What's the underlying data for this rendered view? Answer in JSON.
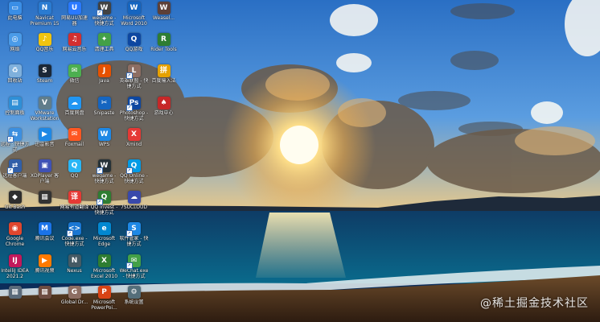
{
  "colors": {
    "sky_top": "#2a6fc4",
    "sun": "#fff2b3",
    "sea": "#0f4c7a",
    "sand": "#4a3420"
  },
  "watermark": "@稀土掘金技术社区",
  "desktop_icons": [
    {
      "label": "此电脑",
      "icon": "computer-icon",
      "color": "#3a8ee6",
      "glyph": "▭",
      "shortcut": false
    },
    {
      "label": "网络",
      "icon": "network-icon",
      "color": "#4a9be8",
      "glyph": "◎",
      "shortcut": false
    },
    {
      "label": "回收站",
      "icon": "recycle-bin-icon",
      "color": "#7fb0dc",
      "glyph": "♻",
      "shortcut": false
    },
    {
      "label": "控制面板",
      "icon": "control-panel-icon",
      "color": "#2f8fd6",
      "glyph": "▤",
      "shortcut": false
    },
    {
      "label": "远程 · 快捷方式",
      "icon": "remote-desktop-icon",
      "color": "#3c8fe0",
      "glyph": "⇆",
      "shortcut": true
    },
    {
      "label": "远程客户端",
      "icon": "remote-client-icon",
      "color": "#315fa8",
      "glyph": "⇄",
      "shortcut": true
    },
    {
      "label": "Git Bash",
      "icon": "git-bash-icon",
      "color": "#2e2e2e",
      "glyph": "◆",
      "shortcut": false
    },
    {
      "label": "Google Chrome",
      "icon": "chrome-icon",
      "color": "#e0462e",
      "glyph": "◉",
      "shortcut": false
    },
    {
      "label": "IntelliJ IDEA 2021.2",
      "icon": "intellij-icon",
      "color": "#c2185b",
      "glyph": "IJ",
      "shortcut": false
    },
    {
      "label": "",
      "icon": "app-icon",
      "color": "#5a6a7a",
      "glyph": "▦",
      "shortcut": false
    },
    {
      "label": "Navicat Premium 15",
      "icon": "navicat-icon",
      "color": "#2a7bd1",
      "glyph": "N",
      "shortcut": false
    },
    {
      "label": "QQ音乐",
      "icon": "qq-music-icon",
      "color": "#f1c40f",
      "glyph": "♪",
      "shortcut": false
    },
    {
      "label": "Steam",
      "icon": "steam-icon",
      "color": "#1b2838",
      "glyph": "S",
      "shortcut": false
    },
    {
      "label": "VMware Workstation",
      "icon": "vmware-icon",
      "color": "#607d8b",
      "glyph": "V",
      "shortcut": false
    },
    {
      "label": "迅雷影音",
      "icon": "video-player-icon",
      "color": "#1e88e5",
      "glyph": "▶",
      "shortcut": false
    },
    {
      "label": "XDPlayer 客户端",
      "icon": "xdplayer-icon",
      "color": "#3f51b5",
      "glyph": "▣",
      "shortcut": false
    },
    {
      "label": "",
      "icon": "app-icon",
      "color": "#333333",
      "glyph": "▦",
      "shortcut": false
    },
    {
      "label": "腾讯会议",
      "icon": "tencent-meeting-icon",
      "color": "#1a73e8",
      "glyph": "M",
      "shortcut": false
    },
    {
      "label": "腾讯视频",
      "icon": "tencent-video-icon",
      "color": "#ff7a00",
      "glyph": "▶",
      "shortcut": false
    },
    {
      "label": "",
      "icon": "app-icon",
      "color": "#6d4c41",
      "glyph": "▦",
      "shortcut": false
    },
    {
      "label": "网易UU加速器",
      "icon": "uu-booster-icon",
      "color": "#2979ff",
      "glyph": "U",
      "shortcut": false
    },
    {
      "label": "网易云音乐",
      "icon": "netease-music-icon",
      "color": "#d32f2f",
      "glyph": "♫",
      "shortcut": false
    },
    {
      "label": "微信",
      "icon": "wechat-icon",
      "color": "#4caf50",
      "glyph": "✉",
      "shortcut": false
    },
    {
      "label": "百度网盘",
      "icon": "baidu-netdisk-icon",
      "color": "#2196f3",
      "glyph": "☁",
      "shortcut": false
    },
    {
      "label": "Foxmail",
      "icon": "foxmail-icon",
      "color": "#ff5722",
      "glyph": "✉",
      "shortcut": false
    },
    {
      "label": "QQ",
      "icon": "qq-icon",
      "color": "#29b6f6",
      "glyph": "Q",
      "shortcut": false
    },
    {
      "label": "网易有道翻译",
      "icon": "youdao-icon",
      "color": "#e53935",
      "glyph": "译",
      "shortcut": false
    },
    {
      "label": "Code.exe - 快捷方式",
      "icon": "vscode-icon",
      "color": "#1976d2",
      "glyph": "<>",
      "shortcut": true
    },
    {
      "label": "Nexus",
      "icon": "nexus-icon",
      "color": "#455a64",
      "glyph": "N",
      "shortcut": false
    },
    {
      "label": "Global Dr...",
      "icon": "global-icon",
      "color": "#8d6e63",
      "glyph": "G",
      "shortcut": false
    },
    {
      "label": "wegame - 快捷方式",
      "icon": "wegame-icon",
      "color": "#424242",
      "glyph": "W",
      "shortcut": true
    },
    {
      "label": "清理工具",
      "icon": "cleaner-icon",
      "color": "#43a047",
      "glyph": "✦",
      "shortcut": false
    },
    {
      "label": "Java",
      "icon": "java-icon",
      "color": "#e65100",
      "glyph": "J",
      "shortcut": false
    },
    {
      "label": "Snipaste",
      "icon": "snipaste-icon",
      "color": "#1565c0",
      "glyph": "✂",
      "shortcut": false
    },
    {
      "label": "WPS",
      "icon": "wps-icon",
      "color": "#1e88e5",
      "glyph": "W",
      "shortcut": false
    },
    {
      "label": "wegame - 快捷方式",
      "icon": "wegame-icon",
      "color": "#263238",
      "glyph": "W",
      "shortcut": true
    },
    {
      "label": "QQ Invest - 快捷方式",
      "icon": "qq-invest-icon",
      "color": "#2e7d32",
      "glyph": "Q",
      "shortcut": true
    },
    {
      "label": "Microsoft Edge",
      "icon": "edge-icon",
      "color": "#0288d1",
      "glyph": "e",
      "shortcut": false
    },
    {
      "label": "Microsoft Excel 2010",
      "icon": "excel-icon",
      "color": "#2e7d32",
      "glyph": "X",
      "shortcut": false
    },
    {
      "label": "Microsoft PowerPoi...",
      "icon": "powerpoint-icon",
      "color": "#d84315",
      "glyph": "P",
      "shortcut": false
    },
    {
      "label": "Microsoft Word 2010",
      "icon": "word-icon",
      "color": "#1565c0",
      "glyph": "W",
      "shortcut": false
    },
    {
      "label": "QQ游戏",
      "icon": "qq-game-icon",
      "color": "#0d47a1",
      "glyph": "Q",
      "shortcut": false
    },
    {
      "label": "英雄联盟 - 快捷方式",
      "icon": "lol-icon",
      "color": "#8d6e63",
      "glyph": "L",
      "shortcut": true
    },
    {
      "label": "Photoshop - 快捷方式",
      "icon": "photoshop-icon",
      "color": "#0d47a1",
      "glyph": "Ps",
      "shortcut": true
    },
    {
      "label": "Xmind",
      "icon": "xmind-icon",
      "color": "#e53935",
      "glyph": "X",
      "shortcut": false
    },
    {
      "label": "QQ Online - 快捷方式",
      "icon": "qq-online-icon",
      "color": "#039be5",
      "glyph": "Q",
      "shortcut": true
    },
    {
      "label": "7SUCLOUD",
      "icon": "cloud-icon",
      "color": "#3949ab",
      "glyph": "☁",
      "shortcut": false
    },
    {
      "label": "软件管家 - 快捷方式",
      "icon": "software-manager-icon",
      "color": "#1e88e5",
      "glyph": "S",
      "shortcut": true
    },
    {
      "label": "WeChat.exe - 快捷方式",
      "icon": "wechat-icon",
      "color": "#43a047",
      "glyph": "✉",
      "shortcut": true
    },
    {
      "label": "系统设置",
      "icon": "settings-icon",
      "color": "#546e7a",
      "glyph": "⚙",
      "shortcut": false
    },
    {
      "label": "Weasel...",
      "icon": "weasel-icon",
      "color": "#5d4037",
      "glyph": "W",
      "shortcut": false
    },
    {
      "label": "Rider Tools",
      "icon": "rider-icon",
      "color": "#2e7d32",
      "glyph": "R",
      "shortcut": false
    },
    {
      "label": "百度输入法",
      "icon": "input-method-icon",
      "color": "#e6a100",
      "glyph": "拼",
      "shortcut": false
    },
    {
      "label": "游戏中心",
      "icon": "game-center-icon",
      "color": "#c62828",
      "glyph": "♠",
      "shortcut": false
    }
  ]
}
